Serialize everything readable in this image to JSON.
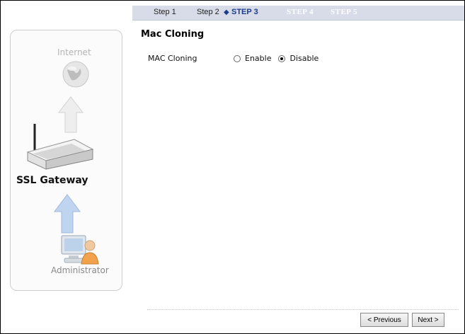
{
  "steps": {
    "step1": "Step 1",
    "step2": "Step 2",
    "step3": "STEP 3",
    "step4": "STEP 4",
    "step5": "STEP 5"
  },
  "sidebar": {
    "internet_label": "Internet",
    "gateway_label": "SSL Gateway",
    "admin_label": "Administrator"
  },
  "main": {
    "title": "Mac Cloning",
    "field_label": "MAC Cloning",
    "options": [
      "Enable",
      "Disable"
    ],
    "selected": "Disable"
  },
  "buttons": {
    "previous": "< Previous",
    "next": "Next >"
  },
  "colors": {
    "stepbar_bg": "#d7dce8",
    "active_step": "#1b3c8a"
  }
}
